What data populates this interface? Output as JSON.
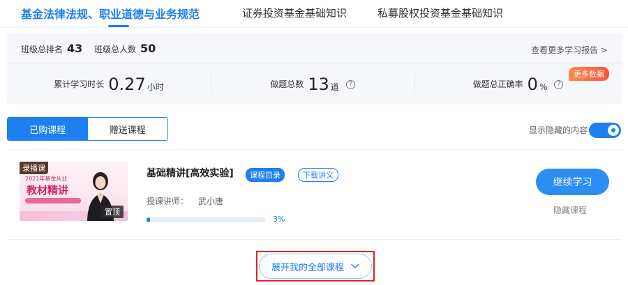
{
  "tabs": [
    {
      "label": "基金法律法规、职业道德与业务规范",
      "active": true
    },
    {
      "label": "证券投资基金基础知识",
      "active": false
    },
    {
      "label": "私募股权投资基金基础知识",
      "active": false
    }
  ],
  "stats": {
    "class_rank_label": "班级总排名",
    "class_rank_value": "43",
    "class_total_label": "班级总人数",
    "class_total_value": "50",
    "report_link": "查看更多学习报告 >",
    "study_time_label": "累计学习时长",
    "study_time_value": "0.27",
    "study_time_unit": "小时",
    "questions_label": "做题总数",
    "questions_value": "13",
    "questions_unit": "道",
    "accuracy_label": "做题总正确率",
    "accuracy_value": "0",
    "accuracy_unit": "%",
    "help_glyph": "?",
    "more_data_badge": "更多数据"
  },
  "course_filter": {
    "purchased": "已购课程",
    "gifted": "赠送课程",
    "show_hidden_label": "显示隐藏的内容",
    "show_hidden_on": true
  },
  "course": {
    "thumb_badge": "录播课",
    "thumb_year": "2021年基金从业",
    "thumb_title": "教材精讲",
    "thumb_pin": "置顶",
    "title": "基础精讲[高效实验]",
    "tag_catalog": "课程目录",
    "tag_handout": "下载讲义",
    "teacher_label": "授课讲师：",
    "teacher_name": "武小唐",
    "progress_percent": 3,
    "progress_text": "3%",
    "continue_label": "继续学习",
    "hide_label": "隐藏课程"
  },
  "expand": {
    "label": "展开我的全部课程"
  },
  "colors": {
    "accent": "#1e7ff0",
    "badge_orange": "#f5553a",
    "highlight_red": "#e0222b"
  }
}
